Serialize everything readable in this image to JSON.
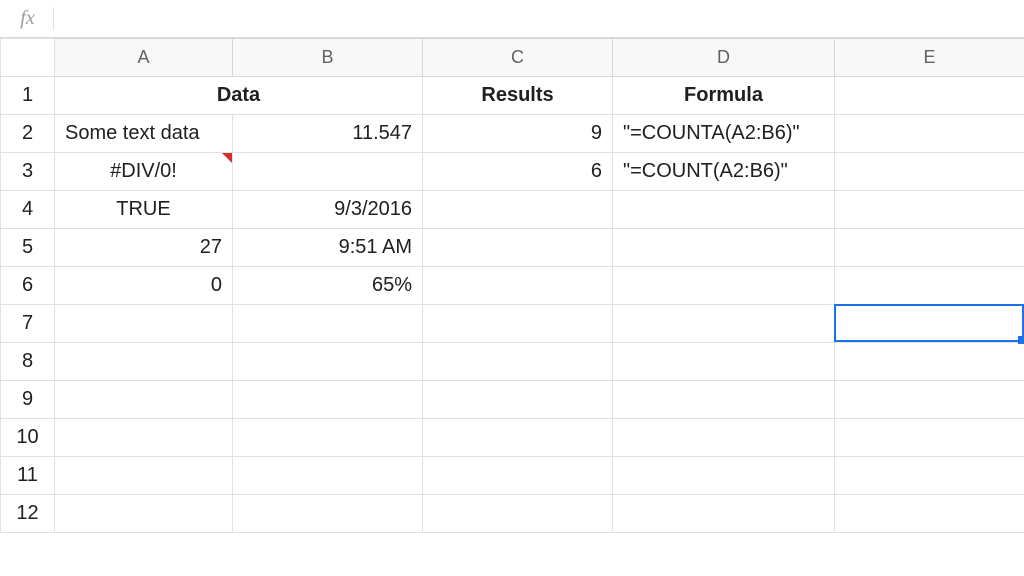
{
  "formula_bar": {
    "fx_label": "fx",
    "value": ""
  },
  "columns": [
    "A",
    "B",
    "C",
    "D",
    "E"
  ],
  "row_numbers": [
    1,
    2,
    3,
    4,
    5,
    6,
    7,
    8,
    9,
    10,
    11,
    12
  ],
  "headers": {
    "data_label": "Data",
    "results_label": "Results",
    "formula_label": "Formula"
  },
  "cells": {
    "A2": "Some text data",
    "B2": "11.547",
    "C2": "9",
    "D2": "\"=COUNTA(A2:B6)\"",
    "A3": "#DIV/0!",
    "C3": "6",
    "D3": "\"=COUNT(A2:B6)\"",
    "A4": "TRUE",
    "B4": "9/3/2016",
    "A5": "27",
    "B5": "9:51 AM",
    "A6": "0",
    "B6": "65%"
  },
  "notes": {
    "A3": true
  },
  "selection": {
    "cell": "E7"
  }
}
